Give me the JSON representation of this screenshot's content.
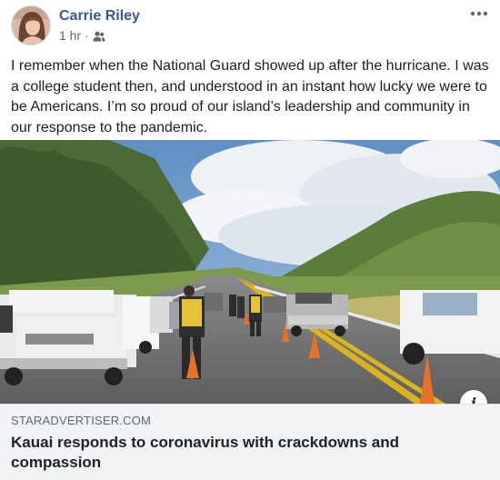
{
  "post": {
    "author": "Carrie Riley",
    "time": "1 hr",
    "separator": "·",
    "audience_icon": "friends-icon",
    "more_icon": "more-horizontal-icon",
    "text": "I remember when the National Guard showed up after the hurricane. I was a college student then, and understood in an instant how lucky we were to be Americans. I’m so proud of our island’s leadership and community in our response to the pandemic."
  },
  "link_preview": {
    "domain": "STARADVERTISER.COM",
    "title": "Kauai responds to coronavirus with crackdowns and compassion",
    "info_label": "i",
    "info_icon": "info-icon"
  },
  "colors": {
    "author_link": "#385898",
    "meta_gray": "#606770",
    "footer_bg": "#f2f3f5"
  }
}
